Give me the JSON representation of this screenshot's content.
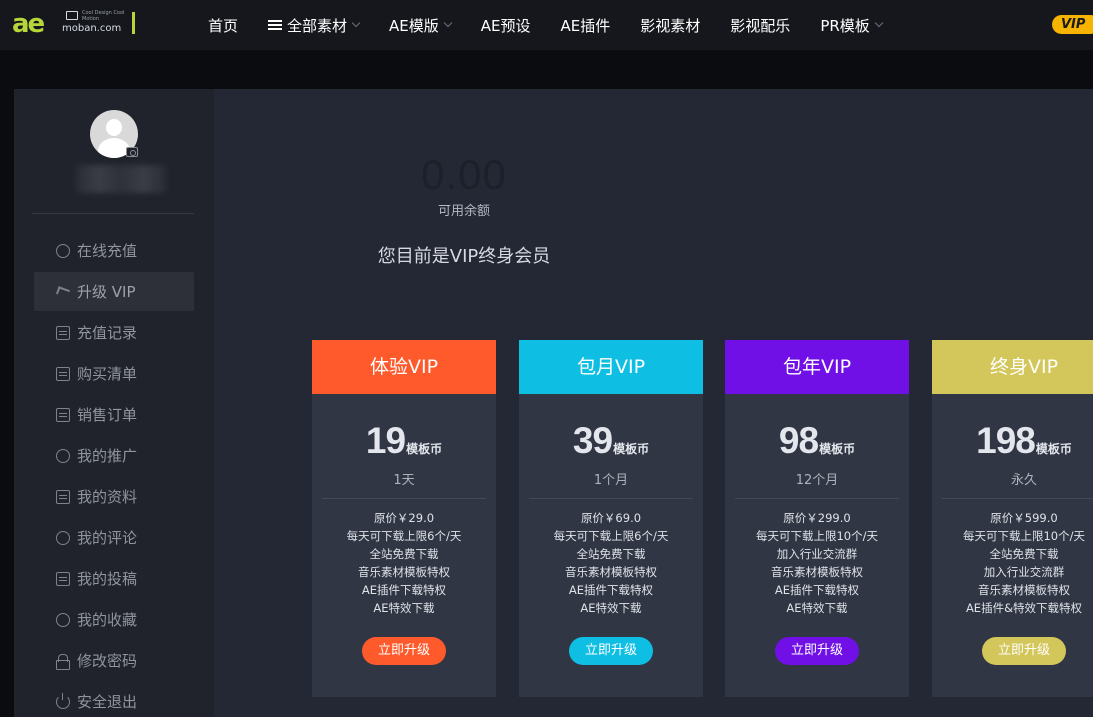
{
  "logo": {
    "mark": "ae",
    "site": "moban.com",
    "tagline": "Cool Design\nCool Motion"
  },
  "nav": {
    "items": [
      {
        "label": "首页",
        "has_icon": false,
        "has_caret": false
      },
      {
        "label": "全部素材",
        "has_icon": true,
        "has_caret": true
      },
      {
        "label": "AE模版",
        "has_icon": false,
        "has_caret": true
      },
      {
        "label": "AE预设",
        "has_icon": false,
        "has_caret": false
      },
      {
        "label": "AE插件",
        "has_icon": false,
        "has_caret": false
      },
      {
        "label": "影视素材",
        "has_icon": false,
        "has_caret": false
      },
      {
        "label": "影视配乐",
        "has_icon": false,
        "has_caret": false
      },
      {
        "label": "PR模板",
        "has_icon": false,
        "has_caret": true
      }
    ],
    "vip_badge": "VIP"
  },
  "sidebar": {
    "menu": [
      {
        "label": "在线充值",
        "icon": "shield-icon",
        "active": false
      },
      {
        "label": "升级 VIP",
        "icon": "paper-plane-icon",
        "active": true
      },
      {
        "label": "充值记录",
        "icon": "receipt-icon",
        "active": false
      },
      {
        "label": "购买清单",
        "icon": "list-icon",
        "active": false
      },
      {
        "label": "销售订单",
        "icon": "order-icon",
        "active": false
      },
      {
        "label": "我的推广",
        "icon": "promotion-icon",
        "active": false
      },
      {
        "label": "我的资料",
        "icon": "profile-card-icon",
        "active": false
      },
      {
        "label": "我的评论",
        "icon": "comment-icon",
        "active": false
      },
      {
        "label": "我的投稿",
        "icon": "document-icon",
        "active": false
      },
      {
        "label": "我的收藏",
        "icon": "star-icon",
        "active": false
      },
      {
        "label": "修改密码",
        "icon": "lock-icon",
        "active": false
      },
      {
        "label": "安全退出",
        "icon": "power-icon",
        "active": false
      }
    ]
  },
  "account": {
    "balance": "0.00",
    "balance_label": "可用余额",
    "member_status": "您目前是VIP终身会员"
  },
  "plans": [
    {
      "name": "体验VIP",
      "price": "19",
      "unit": "模板币",
      "duration": "1天",
      "color": "#ff5a2c",
      "features": [
        "原价￥29.0",
        "每天可下载上限6个/天",
        "全站免费下载",
        "音乐素材模板特权",
        "AE插件下载特权",
        "AE特效下载"
      ],
      "button": "立即升级"
    },
    {
      "name": "包月VIP",
      "price": "39",
      "unit": "模板币",
      "duration": "1个月",
      "color": "#0fbfe3",
      "features": [
        "原价￥69.0",
        "每天可下载上限6个/天",
        "全站免费下载",
        "音乐素材模板特权",
        "AE插件下载特权",
        "AE特效下载"
      ],
      "button": "立即升级"
    },
    {
      "name": "包年VIP",
      "price": "98",
      "unit": "模板币",
      "duration": "12个月",
      "color": "#7010e6",
      "features": [
        "原价￥299.0",
        "每天可下载上限10个/天",
        "加入行业交流群",
        "音乐素材模板特权",
        "AE插件下载特权",
        "AE特效下载"
      ],
      "button": "立即升级"
    },
    {
      "name": "终身VIP",
      "price": "198",
      "unit": "模板币",
      "duration": "永久",
      "color": "#d3c65a",
      "features": [
        "原价￥599.0",
        "每天可下载上限10个/天",
        "全站免费下载",
        "加入行业交流群",
        "音乐素材模板特权",
        "AE插件&特效下载特权"
      ],
      "button": "立即升级"
    }
  ]
}
